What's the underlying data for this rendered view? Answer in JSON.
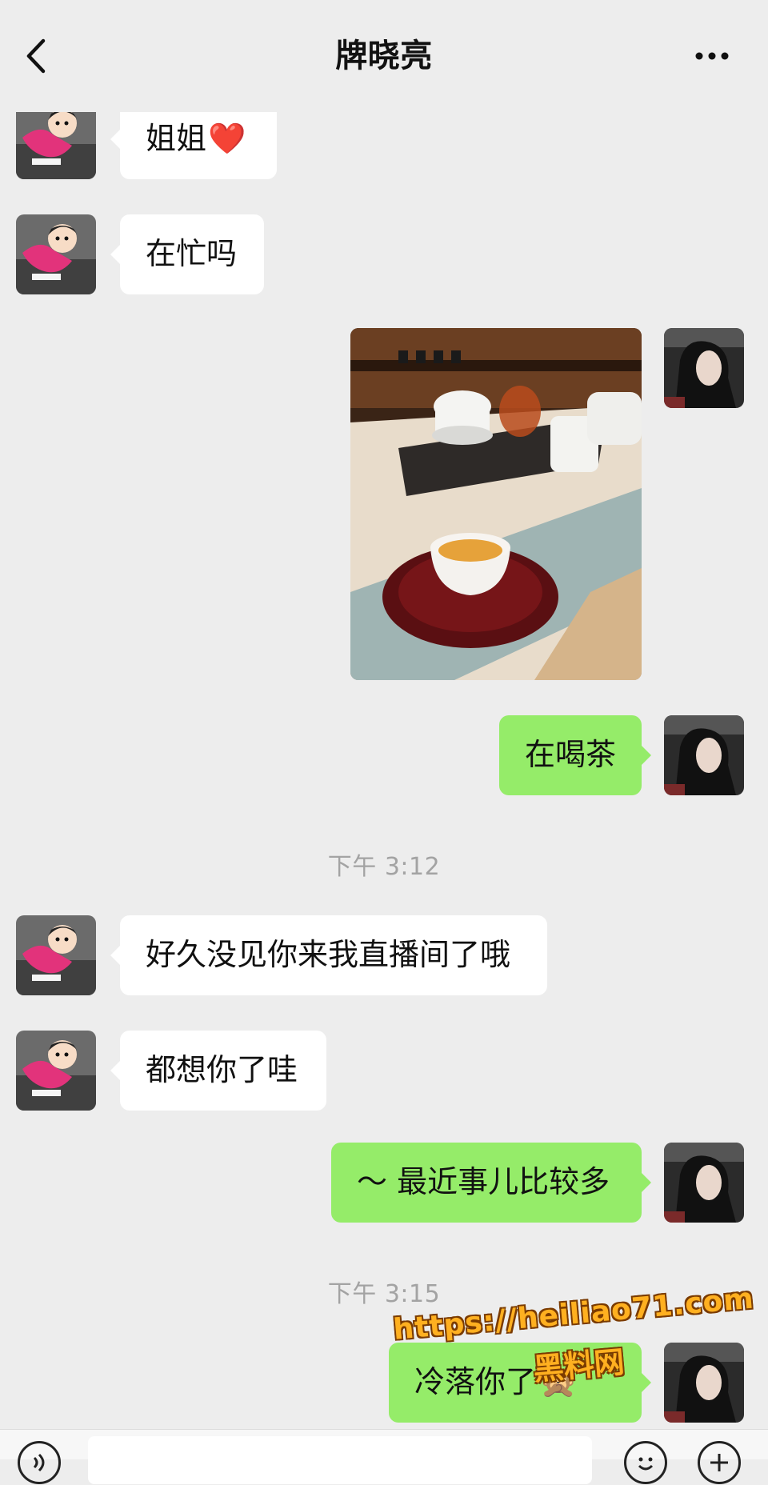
{
  "header": {
    "title": "牌晓亮",
    "back_icon": "chevron-left-icon",
    "more_icon": "ellipsis-icon"
  },
  "colors": {
    "background": "#ededed",
    "bubble_incoming": "#ffffff",
    "bubble_outgoing": "#95ec69",
    "timestamp_text": "#a3a3a3",
    "watermark": "#ffb020"
  },
  "messages": [
    {
      "side": "in",
      "text": "姐姐",
      "emoji": "❤️"
    },
    {
      "side": "in",
      "text": "在忙吗"
    },
    {
      "side": "out",
      "type": "image",
      "image_icon": "tea-photo"
    },
    {
      "side": "out",
      "text": "在喝茶"
    },
    {
      "type": "timestamp",
      "text": "下午 3:12"
    },
    {
      "side": "in",
      "text": "好久没见你来我直播间了哦"
    },
    {
      "side": "in",
      "text": "都想你了哇"
    },
    {
      "side": "out",
      "text": "～ 最近事儿比较多"
    },
    {
      "type": "timestamp",
      "text": "下午 3:15"
    },
    {
      "side": "out",
      "text": "冷落你了",
      "emoji": "🙊"
    }
  ],
  "watermark": {
    "url": "https://heiliao71.com",
    "label": "黑料网"
  },
  "input_bar": {
    "voice_icon": "voice-icon",
    "emoji_icon": "emoji-icon",
    "plus_icon": "plus-icon"
  }
}
